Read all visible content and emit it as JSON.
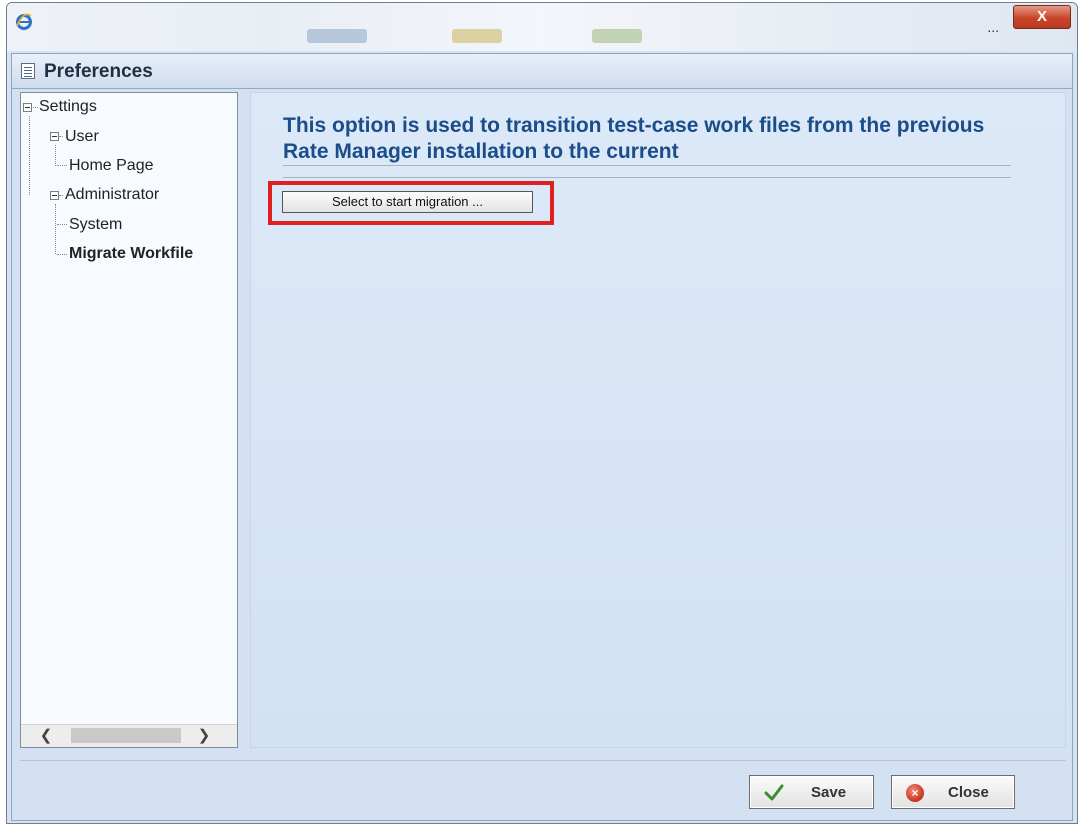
{
  "window": {
    "ellipsis": "...",
    "close_glyph": "X"
  },
  "panel": {
    "title": "Preferences",
    "icon": "preferences-list-icon"
  },
  "tree": {
    "settings": "Settings",
    "user": "User",
    "home_page": "Home Page",
    "administrator": "Administrator",
    "system": "System",
    "migrate_workfiles": "Migrate Workfile",
    "selected": "Migrate Workfile"
  },
  "content": {
    "title": "This option is used to transition test-case work files from the previous Rate Manager installation to the current",
    "migrate_button": "Select to start migration ..."
  },
  "footer": {
    "save_label": "Save",
    "close_label": "Close"
  },
  "colors": {
    "title_text": "#1b4d8a",
    "highlight_border": "#e02020",
    "panel_bg": "#d3e1f3"
  }
}
